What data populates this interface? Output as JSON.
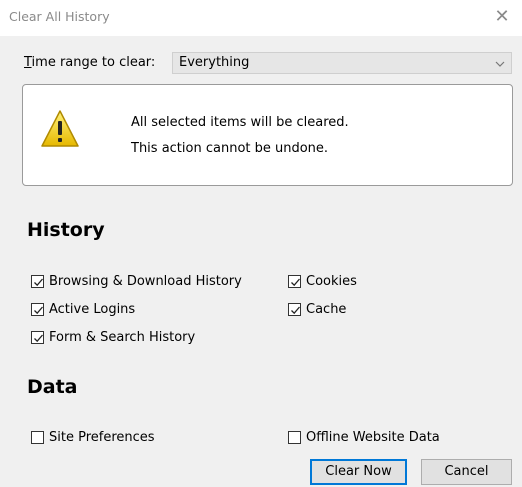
{
  "window": {
    "title": "Clear All History",
    "close_glyph": "✕"
  },
  "time_range": {
    "label_mnemonic": "T",
    "label_rest": "ime range to clear:",
    "selected": "Everything"
  },
  "warning": {
    "line1": "All selected items will be cleared.",
    "line2": "This action cannot be undone."
  },
  "history": {
    "heading": "History",
    "items": [
      {
        "label": "Browsing & Download History",
        "checked": true
      },
      {
        "label": "Cookies",
        "checked": true
      },
      {
        "label": "Active Logins",
        "checked": true
      },
      {
        "label": "Cache",
        "checked": true
      },
      {
        "label": "Form & Search History",
        "checked": true
      }
    ]
  },
  "data": {
    "heading": "Data",
    "items": [
      {
        "label": "Site Preferences",
        "checked": false
      },
      {
        "label": "Offline Website Data",
        "checked": false
      }
    ]
  },
  "buttons": {
    "clear_now": "Clear Now",
    "cancel": "Cancel"
  },
  "colors": {
    "accent": "#0078d7",
    "warning_yellow": "#f5d10a"
  }
}
